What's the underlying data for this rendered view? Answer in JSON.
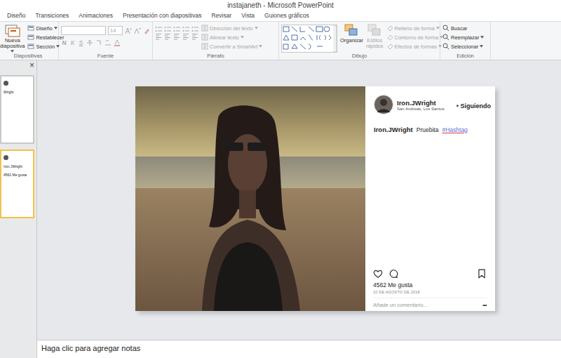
{
  "window": {
    "title": "instajaneth - Microsoft PowerPoint"
  },
  "tabs": [
    {
      "label": "Diseño",
      "selected": false
    },
    {
      "label": "Transiciones",
      "selected": false
    },
    {
      "label": "Animaciones",
      "selected": false
    },
    {
      "label": "Presentación con diapositivas",
      "selected": false
    },
    {
      "label": "Revisar",
      "selected": false
    },
    {
      "label": "Vista",
      "selected": false
    },
    {
      "label": "Guiones gráficos",
      "selected": false
    }
  ],
  "ribbon": {
    "slides": {
      "label": "Diapositivas",
      "new_slide": {
        "label": "Nueva diapositiva",
        "disabled": false
      },
      "items": [
        {
          "label": "Diseño",
          "dropdown": true,
          "disabled": false
        },
        {
          "label": "Restablecer",
          "dropdown": false,
          "disabled": false
        },
        {
          "label": "Sección",
          "dropdown": true,
          "disabled": false
        }
      ]
    },
    "font": {
      "label": "Fuente",
      "size": "14",
      "format_buttons": [
        {
          "label": "N",
          "kind": "bold",
          "disabled": true
        },
        {
          "label": "K",
          "kind": "italic",
          "disabled": true
        },
        {
          "label": "S",
          "kind": "underline",
          "disabled": true
        }
      ]
    },
    "paragraph": {
      "label": "Párrafo",
      "items": [
        {
          "label": "Dirección del texto",
          "dropdown": true,
          "disabled": true
        },
        {
          "label": "Alinear texto",
          "dropdown": true,
          "disabled": true
        },
        {
          "label": "Convertir a SmartArt",
          "dropdown": true,
          "disabled": true
        }
      ]
    },
    "drawing": {
      "label": "Dibujo",
      "large": [
        {
          "label": "Organizar",
          "disabled": false
        },
        {
          "label": "Estilos rápidos",
          "disabled": true
        }
      ],
      "items": [
        {
          "label": "Relleno de forma",
          "dropdown": true,
          "disabled": true
        },
        {
          "label": "Contorno de forma",
          "dropdown": true,
          "disabled": true
        },
        {
          "label": "Efectos de formas",
          "dropdown": true,
          "disabled": true
        }
      ]
    },
    "editing": {
      "label": "Edición",
      "items": [
        {
          "label": "Buscar",
          "dropdown": false,
          "disabled": false
        },
        {
          "label": "Reemplazar",
          "dropdown": true,
          "disabled": false
        },
        {
          "label": "Seleccionar",
          "dropdown": true,
          "disabled": false
        }
      ]
    }
  },
  "slides_pane": {
    "close": "×",
    "thumbnails": [
      {
        "selected": false,
        "texts": [
          "Wright"
        ]
      },
      {
        "selected": true,
        "texts": [
          "Iron.JWright",
          "4562 Me gusta"
        ]
      }
    ]
  },
  "post": {
    "user": "Iron.JWright",
    "location": "San Andreas, Los Santos",
    "follow": "• Siguiendo",
    "caption": {
      "user": "Iron.JWright",
      "text": "Pruebita",
      "hashtag": "#Hashtag"
    },
    "likes": "4562 Me gusta",
    "date": "10 DE AGOSTO DE 2018",
    "comment_placeholder": "Añade un comentario...",
    "more": "•••",
    "liked": false,
    "saved": false
  },
  "notes": {
    "placeholder": "Haga clic para agregar notas"
  }
}
